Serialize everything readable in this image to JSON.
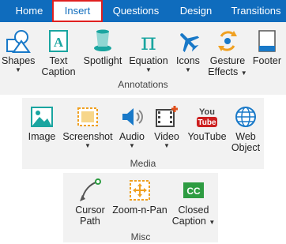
{
  "ribbon": {
    "tabs": [
      {
        "label": "Home"
      },
      {
        "label": "Insert"
      },
      {
        "label": "Questions"
      },
      {
        "label": "Design"
      },
      {
        "label": "Transitions"
      }
    ]
  },
  "annotations": {
    "label": "Annotations",
    "items": [
      {
        "label": "Shapes",
        "icon": "shapes-icon",
        "has_dropdown": true
      },
      {
        "label": "Text\nCaption",
        "icon": "text-caption-icon"
      },
      {
        "label": "Spotlight",
        "icon": "spotlight-icon"
      },
      {
        "label": "Equation",
        "icon": "pi-icon",
        "has_dropdown": true
      },
      {
        "label": "Icons",
        "icon": "airplane-icon",
        "has_dropdown": true
      },
      {
        "label": "Gesture\nEffects",
        "icon": "gesture-icon",
        "has_dropdown": true
      },
      {
        "label": "Footer",
        "icon": "footer-icon"
      }
    ]
  },
  "media": {
    "label": "Media",
    "items": [
      {
        "label": "Image",
        "icon": "image-icon"
      },
      {
        "label": "Screenshot",
        "icon": "screenshot-icon",
        "has_dropdown": true
      },
      {
        "label": "Audio",
        "icon": "speaker-icon",
        "has_dropdown": true
      },
      {
        "label": "Video",
        "icon": "video-icon",
        "has_dropdown": true
      },
      {
        "label": "YouTube",
        "icon": "youtube-icon",
        "badge": "You Tube"
      },
      {
        "label": "Web\nObject",
        "icon": "globe-icon"
      }
    ]
  },
  "misc": {
    "label": "Misc",
    "items": [
      {
        "label": "Cursor\nPath",
        "icon": "cursor-path-icon"
      },
      {
        "label": "Zoom-n-Pan",
        "icon": "zoom-pan-icon"
      },
      {
        "label": "Closed\nCaption",
        "icon": "closed-caption-icon",
        "has_dropdown": true,
        "badge": "CC"
      }
    ]
  },
  "colors": {
    "ribbon_blue": "#0f6cbd",
    "panel_gray": "#f2f2f2",
    "active_tab_border": "#e02020",
    "icon_blue": "#1979c8",
    "icon_teal": "#1aa5a0",
    "icon_orange": "#f0a020",
    "youtube_red": "#cc1f1f",
    "cc_green": "#2e9c42"
  }
}
